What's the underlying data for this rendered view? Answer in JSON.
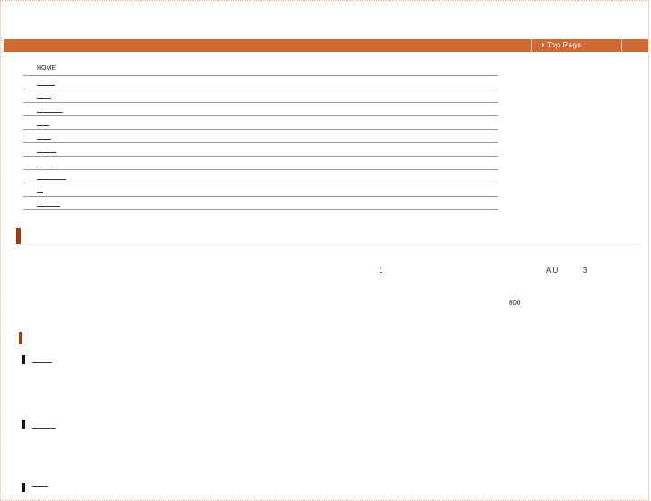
{
  "header": {
    "top_page_label": "Top Page"
  },
  "nav": {
    "items": [
      {
        "label": "HOME"
      },
      {
        "label": ""
      },
      {
        "label": ""
      },
      {
        "label": ""
      },
      {
        "label": ""
      },
      {
        "label": ""
      },
      {
        "label": ""
      },
      {
        "label": ""
      },
      {
        "label": ""
      },
      {
        "label": ""
      },
      {
        "label": ""
      }
    ]
  },
  "content": {
    "text_1": "1",
    "text_aiu": "AIU",
    "text_3": "3",
    "text_800": "800"
  },
  "colors": {
    "accent": "#cf6a35",
    "marker": "#a3390f",
    "frame": "#f1b27a"
  }
}
